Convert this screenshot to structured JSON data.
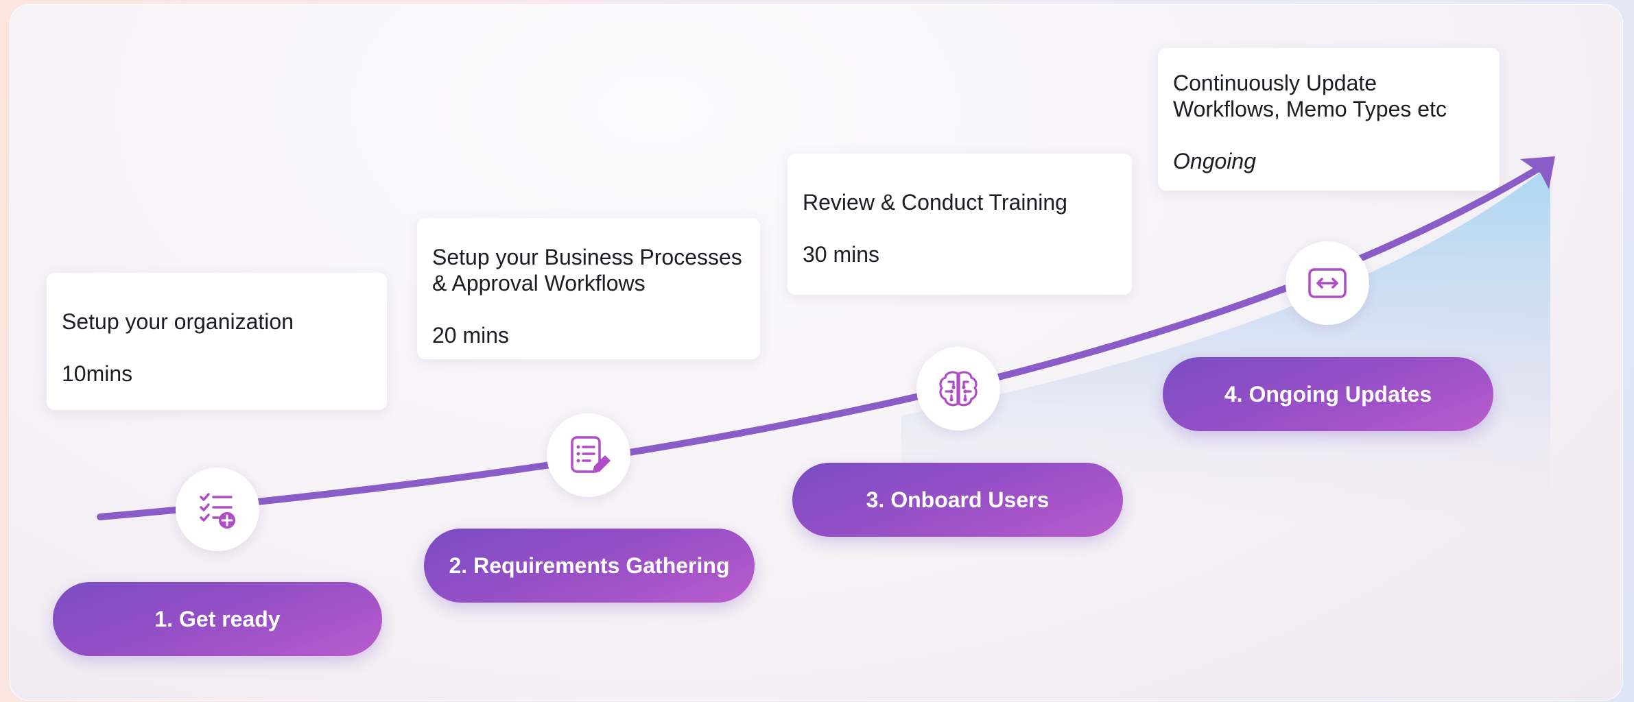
{
  "colors": {
    "accent_purple": "#8a5cc8",
    "pill_start": "#7a4cc3",
    "pill_end": "#b95ccd",
    "icon_magenta": "#b04cc8",
    "area_blue": "#a7d6f2",
    "card_text": "#1c1c22"
  },
  "steps": [
    {
      "label": "1. Get ready",
      "card_title": "Setup your organization",
      "duration": "10mins",
      "icon": "checklist-add-icon"
    },
    {
      "label": "2. Requirements Gathering",
      "card_title": "Setup your Business Processes\n& Approval Workflows",
      "duration": "20 mins",
      "icon": "document-edit-icon"
    },
    {
      "label": "3.  Onboard Users",
      "card_title": "Review & Conduct Training",
      "duration": "30 mins",
      "icon": "brain-icon"
    },
    {
      "label": "4. Ongoing Updates",
      "card_title": "Continuously Update\nWorkflows, Memo Types etc",
      "duration": "Ongoing",
      "icon": "arrows-expand-icon"
    }
  ]
}
